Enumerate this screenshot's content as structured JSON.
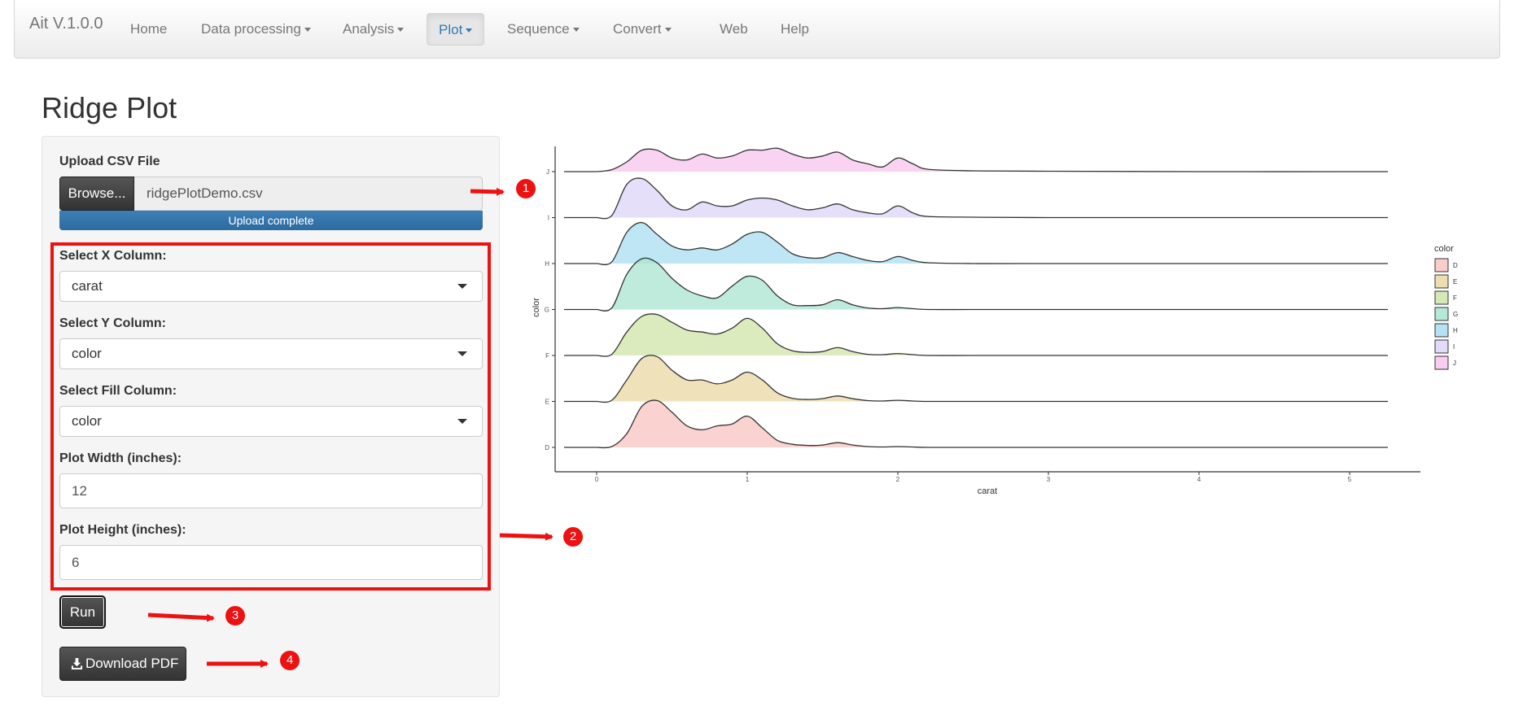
{
  "navbar": {
    "brand": "Ait V.1.0.0",
    "items": [
      {
        "label": "Home",
        "dropdown": false,
        "active": false
      },
      {
        "label": "Data processing",
        "dropdown": true,
        "active": false
      },
      {
        "label": "Analysis",
        "dropdown": true,
        "active": false
      },
      {
        "label": "Plot",
        "dropdown": true,
        "active": true
      },
      {
        "label": "Sequence",
        "dropdown": true,
        "active": false
      },
      {
        "label": "Convert",
        "dropdown": true,
        "active": false
      },
      {
        "label": "Web",
        "dropdown": false,
        "active": false
      },
      {
        "label": "Help",
        "dropdown": false,
        "active": false
      }
    ],
    "active_color": "#337ab7"
  },
  "page": {
    "title": "Ridge Plot"
  },
  "sidebar": {
    "upload_label": "Upload CSV File",
    "browse_label": "Browse...",
    "file_name": "ridgePlotDemo.csv",
    "upload_status": "Upload complete",
    "x_label": "Select X Column:",
    "x_value": "carat",
    "y_label": "Select Y Column:",
    "y_value": "color",
    "fill_label": "Select Fill Column:",
    "fill_value": "color",
    "width_label": "Plot Width (inches):",
    "width_value": "12",
    "height_label": "Plot Height (inches):",
    "height_value": "6",
    "run_label": "Run",
    "download_label": "Download PDF"
  },
  "annotations": {
    "badges": [
      "1",
      "2",
      "3",
      "4"
    ],
    "color": "#ee1111"
  },
  "chart_data": {
    "type": "area",
    "xlabel": "carat",
    "ylabel": "color",
    "x_ticks": [
      "0",
      "1",
      "2",
      "3",
      "4",
      "5"
    ],
    "xlim": [
      0,
      5.2
    ],
    "categories": [
      "D",
      "E",
      "F",
      "G",
      "H",
      "I",
      "J"
    ],
    "legend": {
      "title": "color",
      "position": "right",
      "entries": [
        "D",
        "E",
        "F",
        "G",
        "H",
        "I",
        "J"
      ]
    },
    "colors": [
      "#f8c4c0",
      "#ead8a4",
      "#cfe4a8",
      "#a8e4cf",
      "#a8ddf0",
      "#dcd4f8",
      "#f8c4ee"
    ],
    "grid": false,
    "x": [
      0,
      0.1,
      0.2,
      0.3,
      0.4,
      0.5,
      0.6,
      0.7,
      0.8,
      0.9,
      1.0,
      1.1,
      1.2,
      1.3,
      1.4,
      1.5,
      1.6,
      1.7,
      1.8,
      1.9,
      2.0,
      2.1,
      2.2,
      2.5,
      3.0,
      4.0,
      5.2
    ],
    "series": [
      {
        "name": "D",
        "values": [
          0,
          0.02,
          0.35,
          1.05,
          1.2,
          0.9,
          0.55,
          0.45,
          0.55,
          0.6,
          0.8,
          0.5,
          0.18,
          0.08,
          0.05,
          0.06,
          0.12,
          0.06,
          0.02,
          0.01,
          0.02,
          0.01,
          0,
          0,
          0,
          0,
          0
        ]
      },
      {
        "name": "E",
        "values": [
          0,
          0.03,
          0.55,
          1.1,
          1.15,
          0.8,
          0.55,
          0.55,
          0.45,
          0.55,
          0.75,
          0.55,
          0.22,
          0.08,
          0.05,
          0.07,
          0.14,
          0.07,
          0.02,
          0.01,
          0.03,
          0.01,
          0,
          0,
          0,
          0,
          0
        ]
      },
      {
        "name": "F",
        "values": [
          0,
          0.03,
          0.6,
          1.0,
          1.05,
          0.85,
          0.65,
          0.6,
          0.55,
          0.7,
          0.95,
          0.7,
          0.3,
          0.12,
          0.08,
          0.1,
          0.2,
          0.1,
          0.03,
          0.02,
          0.05,
          0.02,
          0,
          0,
          0,
          0,
          0
        ]
      },
      {
        "name": "G",
        "values": [
          0,
          0.04,
          0.9,
          1.3,
          1.2,
          0.8,
          0.5,
          0.35,
          0.3,
          0.6,
          0.85,
          0.75,
          0.35,
          0.12,
          0.1,
          0.12,
          0.25,
          0.12,
          0.04,
          0.02,
          0.05,
          0.02,
          0,
          0,
          0,
          0,
          0
        ]
      },
      {
        "name": "H",
        "values": [
          0,
          0.04,
          0.8,
          1.05,
          0.75,
          0.45,
          0.35,
          0.4,
          0.35,
          0.5,
          0.75,
          0.8,
          0.55,
          0.25,
          0.15,
          0.15,
          0.28,
          0.18,
          0.08,
          0.05,
          0.18,
          0.08,
          0.02,
          0,
          0,
          0,
          0
        ]
      },
      {
        "name": "I",
        "values": [
          0,
          0.05,
          0.85,
          1.0,
          0.7,
          0.3,
          0.2,
          0.4,
          0.3,
          0.3,
          0.45,
          0.5,
          0.45,
          0.3,
          0.2,
          0.25,
          0.35,
          0.2,
          0.12,
          0.1,
          0.3,
          0.12,
          0.03,
          0.01,
          0,
          0,
          0
        ]
      },
      {
        "name": "J",
        "values": [
          0,
          0.05,
          0.25,
          0.55,
          0.55,
          0.35,
          0.3,
          0.45,
          0.35,
          0.4,
          0.55,
          0.55,
          0.6,
          0.45,
          0.35,
          0.4,
          0.5,
          0.3,
          0.2,
          0.12,
          0.35,
          0.2,
          0.06,
          0.02,
          0.01,
          0,
          0
        ]
      }
    ]
  }
}
